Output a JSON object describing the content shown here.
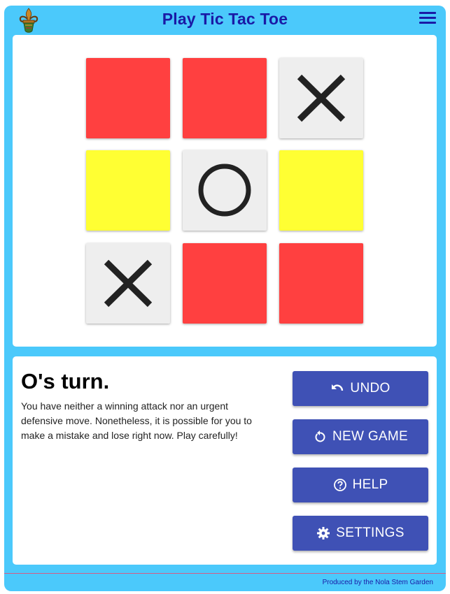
{
  "header": {
    "title": "Play Tic Tac Toe",
    "logo_icon": "fleur-de-lis-icon",
    "menu_icon": "hamburger-menu-icon"
  },
  "board": {
    "cells": [
      {
        "mark": "",
        "color": "#ff4040"
      },
      {
        "mark": "",
        "color": "#ff4040"
      },
      {
        "mark": "X",
        "color": "#eeeeee"
      },
      {
        "mark": "",
        "color": "#ffff33"
      },
      {
        "mark": "O",
        "color": "#eeeeee"
      },
      {
        "mark": "",
        "color": "#ffff33"
      },
      {
        "mark": "X",
        "color": "#eeeeee"
      },
      {
        "mark": "",
        "color": "#ff4040"
      },
      {
        "mark": "",
        "color": "#ff4040"
      }
    ]
  },
  "status": {
    "turn": "O's turn.",
    "hint": "You have neither a winning attack nor an urgent defensive move. Nonetheless, it is possible for you to make a mistake and lose right now. Play carefully!"
  },
  "buttons": {
    "undo": {
      "label": "UNDO",
      "icon": "undo-icon"
    },
    "new_game": {
      "label": "NEW GAME",
      "icon": "restart-icon"
    },
    "help": {
      "label": "HELP",
      "icon": "help-circle-icon"
    },
    "settings": {
      "label": "SETTINGS",
      "icon": "gear-icon"
    }
  },
  "footer": {
    "credit": "Produced by the Nola Stem Garden"
  },
  "colors": {
    "app_background": "#4bc9fb",
    "title": "#1a1aa6",
    "button": "#3f51b5",
    "threat_red": "#ff4040",
    "caution_yellow": "#ffff33",
    "played_cell": "#eeeeee",
    "mark": "#222222"
  }
}
